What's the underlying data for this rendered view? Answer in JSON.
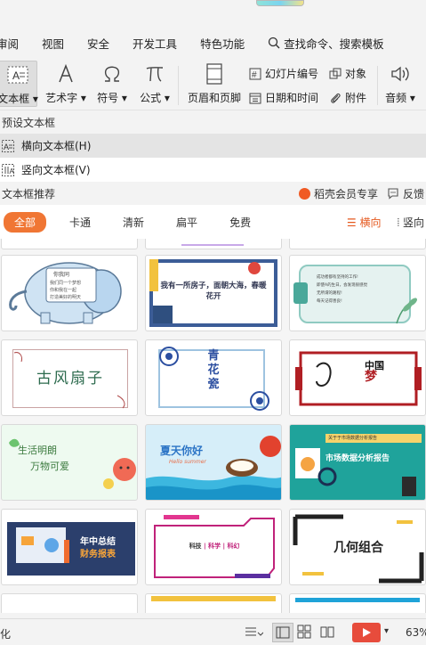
{
  "menubar": {
    "items": [
      "审阅",
      "视图",
      "安全",
      "开发工具",
      "特色功能"
    ],
    "search_label": "查找命令、搜索模板"
  },
  "ribbon": {
    "textbox": "文本框",
    "wordart": "艺术字",
    "symbol": "符号",
    "formula": "公式",
    "header_footer": "页眉和页脚",
    "slide_number": "幻灯片编号",
    "datetime": "日期和时间",
    "object": "对象",
    "attachment": "附件",
    "audio": "音频"
  },
  "panel": {
    "preset_title": "预设文本框",
    "horizontal": "横向文本框(H)",
    "vertical": "竖向文本框(V)",
    "recommend_title": "文本框推荐",
    "vip_label": "稻壳会员专享",
    "feedback": "反馈",
    "filters": [
      "全部",
      "卡通",
      "清新",
      "扁平",
      "免费"
    ],
    "orient_h": "横向",
    "orient_v": "竖向"
  },
  "cards": {
    "c1": [
      "你我同",
      "我们同一个梦想",
      "你和我在一起",
      "打造美好的明天"
    ],
    "c2": "我有一所房子，面朝大海，春暖花开",
    "c3": [
      "成功者都有坚持的工作!",
      "即使A的生日，会发现很感觉",
      "无所谓的路程!",
      "每天记得善良!"
    ],
    "c4": "古风扇子",
    "c5": [
      "青",
      "花",
      "瓷"
    ],
    "c6": [
      "中国",
      "梦"
    ],
    "c7": [
      "生活明朗",
      "万物可爱"
    ],
    "c8": [
      "夏天你好",
      "Hello summer"
    ],
    "c9": [
      "关于于市场数据分析报告",
      "市场数据分析报告"
    ],
    "c10": [
      "年中总结",
      "财务报表"
    ],
    "c11": [
      "科技",
      "科学",
      "科幻"
    ],
    "c12": "几何组合"
  },
  "statusbar": {
    "left": "化",
    "zoom": "63%"
  },
  "colors": {
    "accent": "#f07634",
    "vip": "#f05a24"
  }
}
